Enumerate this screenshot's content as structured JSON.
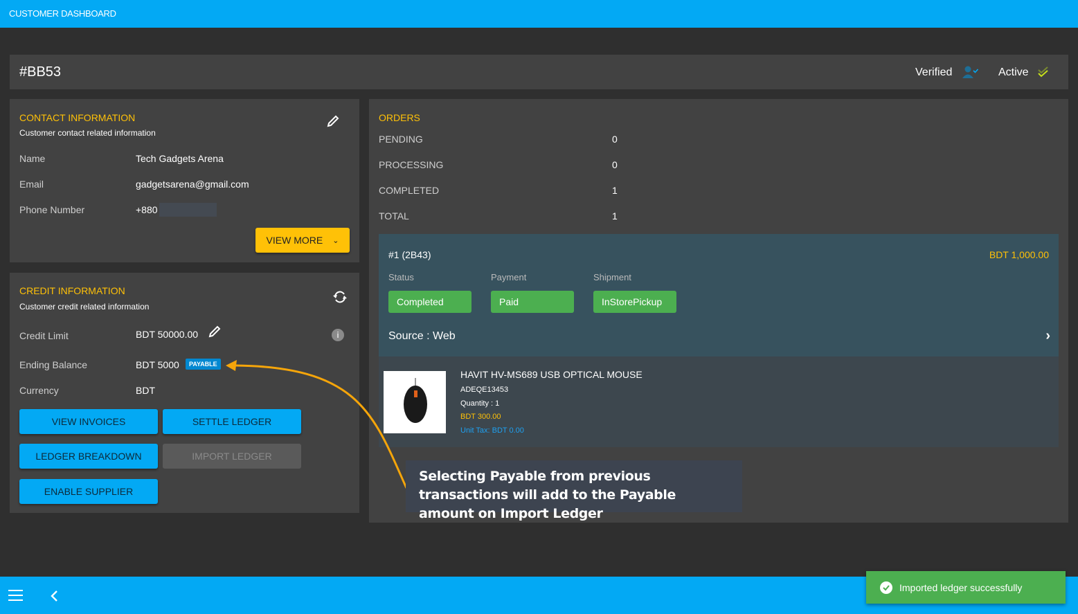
{
  "app_title": "CUSTOMER DASHBOARD",
  "customer": {
    "id": "#BB53",
    "verified_label": "Verified",
    "active_label": "Active"
  },
  "contact": {
    "title": "CONTACT INFORMATION",
    "subtitle": "Customer contact related information",
    "fields": [
      {
        "label": "Name",
        "value": "Tech Gadgets Arena"
      },
      {
        "label": "Email",
        "value": "gadgetsarena@gmail.com"
      },
      {
        "label": "Phone Number",
        "value": "+880"
      }
    ],
    "view_more": "VIEW MORE"
  },
  "credit": {
    "title": "CREDIT INFORMATION",
    "subtitle": "Customer credit related information",
    "credit_limit_label": "Credit Limit",
    "credit_limit": "BDT 50000.00",
    "ending_balance_label": "Ending Balance",
    "ending_balance": "BDT 5000",
    "balance_badge": "PAYABLE",
    "currency_label": "Currency",
    "currency": "BDT",
    "buttons": {
      "view_invoices": "VIEW INVOICES",
      "settle_ledger": "SETTLE LEDGER",
      "ledger_breakdown": "LEDGER BREAKDOWN",
      "import_ledger": "IMPORT LEDGER",
      "enable_supplier": "ENABLE SUPPLIER"
    }
  },
  "orders": {
    "title": "ORDERS",
    "stats": [
      {
        "label": "PENDING",
        "value": "0"
      },
      {
        "label": "PROCESSING",
        "value": "0"
      },
      {
        "label": "COMPLETED",
        "value": "1"
      },
      {
        "label": "TOTAL",
        "value": "1"
      }
    ],
    "order": {
      "id": "#1 (2B43)",
      "amount": "BDT 1,000.00",
      "status_label": "Status",
      "status": "Completed",
      "payment_label": "Payment",
      "payment": "Paid",
      "shipment_label": "Shipment",
      "shipment": "InStorePickup",
      "source": "Source : Web",
      "item": {
        "name": "HAVIT HV-MS689 USB OPTICAL MOUSE",
        "sku": "ADEQE13453",
        "quantity": "Quantity : 1",
        "price": "BDT 300.00",
        "tax": "Unit Tax: BDT 0.00"
      }
    }
  },
  "callout": "Selecting Payable from previous transactions will add to the Payable amount on Import Ledger",
  "toast": "Imported ledger successfully",
  "colors": {
    "primary": "#03a9f4",
    "accent": "#ffc107",
    "success": "#4caf50"
  }
}
